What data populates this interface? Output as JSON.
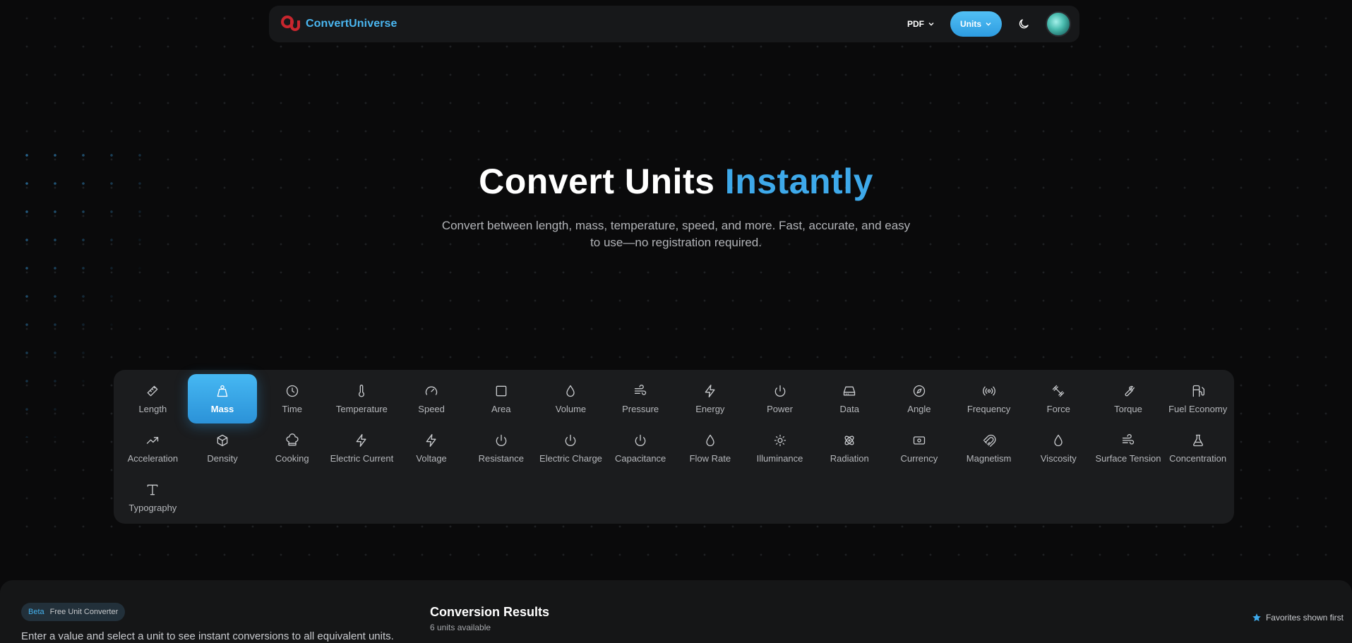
{
  "brand": {
    "name": "ConvertUniverse",
    "accent": "#3ea9ea"
  },
  "nav": {
    "pdf_label": "PDF",
    "units_label": "Units",
    "theme_icon": "moon-icon",
    "avatar": "user-avatar"
  },
  "hero": {
    "title_main": "Convert Units ",
    "title_accent": "Instantly",
    "subtitle": "Convert between length, mass, temperature, speed, and more. Fast, accurate, and easy to use—no registration required."
  },
  "categories": [
    {
      "label": "Length",
      "icon": "ruler-icon"
    },
    {
      "label": "Mass",
      "icon": "weight-icon",
      "active": true
    },
    {
      "label": "Time",
      "icon": "clock-icon"
    },
    {
      "label": "Temperature",
      "icon": "thermometer-icon"
    },
    {
      "label": "Speed",
      "icon": "gauge-icon"
    },
    {
      "label": "Area",
      "icon": "square-icon"
    },
    {
      "label": "Volume",
      "icon": "droplet-icon"
    },
    {
      "label": "Pressure",
      "icon": "wind-icon"
    },
    {
      "label": "Energy",
      "icon": "bolt-icon"
    },
    {
      "label": "Power",
      "icon": "power-icon"
    },
    {
      "label": "Data",
      "icon": "hard-drive-icon"
    },
    {
      "label": "Angle",
      "icon": "compass-icon"
    },
    {
      "label": "Frequency",
      "icon": "radio-icon"
    },
    {
      "label": "Force",
      "icon": "dumbbell-icon"
    },
    {
      "label": "Torque",
      "icon": "wrench-icon"
    },
    {
      "label": "Fuel Economy",
      "icon": "fuel-icon"
    },
    {
      "label": "Acceleration",
      "icon": "trending-up-icon"
    },
    {
      "label": "Density",
      "icon": "box-icon"
    },
    {
      "label": "Cooking",
      "icon": "chef-hat-icon"
    },
    {
      "label": "Electric Current",
      "icon": "bolt-icon"
    },
    {
      "label": "Voltage",
      "icon": "bolt-icon"
    },
    {
      "label": "Resistance",
      "icon": "power-icon"
    },
    {
      "label": "Electric Charge",
      "icon": "power-icon"
    },
    {
      "label": "Capacitance",
      "icon": "power-icon"
    },
    {
      "label": "Flow Rate",
      "icon": "droplet-icon"
    },
    {
      "label": "Illuminance",
      "icon": "sun-icon"
    },
    {
      "label": "Radiation",
      "icon": "atom-icon"
    },
    {
      "label": "Currency",
      "icon": "banknote-icon"
    },
    {
      "label": "Magnetism",
      "icon": "magnet-icon"
    },
    {
      "label": "Viscosity",
      "icon": "droplet-icon"
    },
    {
      "label": "Surface Tension",
      "icon": "wind-icon"
    },
    {
      "label": "Concentration",
      "icon": "flask-icon"
    },
    {
      "label": "Typography",
      "icon": "type-icon"
    }
  ],
  "converter": {
    "badge_beta": "Beta",
    "badge_text": "Free Unit Converter",
    "instructions": "Enter a value and select a unit to see instant conversions to all equivalent units.",
    "results_title": "Conversion Results",
    "results_count": "6 units available",
    "favorites_note": "Favorites shown first"
  }
}
